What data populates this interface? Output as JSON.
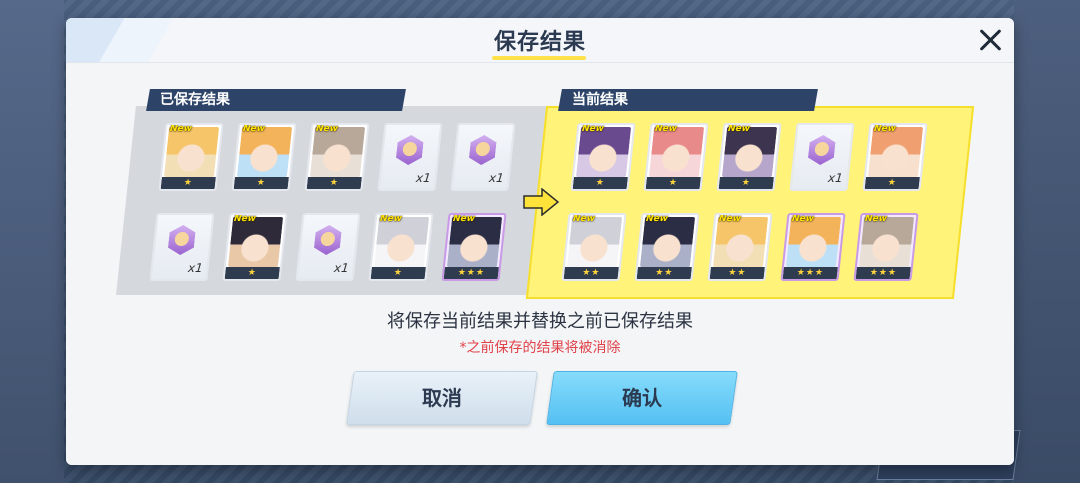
{
  "dialog": {
    "title": "保存结果",
    "saved_label": "已保存结果",
    "current_label": "当前结果",
    "message": "将保存当前结果并替换之前已保存结果",
    "warning": "*之前保存的结果将被消除",
    "cancel_label": "取消",
    "confirm_label": "确认"
  },
  "saved_results": [
    {
      "type": "student",
      "new": "New",
      "stars": "★"
    },
    {
      "type": "student",
      "new": "New",
      "stars": "★"
    },
    {
      "type": "student",
      "new": "New",
      "stars": "★"
    },
    {
      "type": "eleph",
      "count": "x1"
    },
    {
      "type": "eleph",
      "count": "x1"
    },
    {
      "type": "eleph",
      "count": "x1"
    },
    {
      "type": "student",
      "new": "New",
      "stars": "★"
    },
    {
      "type": "eleph",
      "count": "x1"
    },
    {
      "type": "student",
      "new": "New",
      "stars": "★"
    },
    {
      "type": "student",
      "new": "New",
      "stars": "★★★"
    }
  ],
  "current_results": [
    {
      "type": "student",
      "new": "New",
      "stars": "★"
    },
    {
      "type": "student",
      "new": "New",
      "stars": "★"
    },
    {
      "type": "student",
      "new": "New",
      "stars": "★"
    },
    {
      "type": "eleph",
      "count": "x1"
    },
    {
      "type": "student",
      "new": "New",
      "stars": "★"
    },
    {
      "type": "student",
      "new": "New",
      "stars": "★★"
    },
    {
      "type": "student",
      "new": "New",
      "stars": "★★"
    },
    {
      "type": "student",
      "new": "New",
      "stars": "★★"
    },
    {
      "type": "student",
      "new": "New",
      "stars": "★★★"
    },
    {
      "type": "student",
      "new": "New",
      "stars": "★★★"
    }
  ],
  "colors": {
    "panel_saved": "#d5d8dc",
    "panel_current": "#fff37a",
    "label_bg": "#2d4468",
    "confirm_btn": "#55c0f3",
    "warning_text": "#e0424a",
    "title_underline": "#ffe14a"
  },
  "icons": {
    "close": "close-icon",
    "arrow": "arrow-right-icon",
    "star": "star-icon"
  }
}
